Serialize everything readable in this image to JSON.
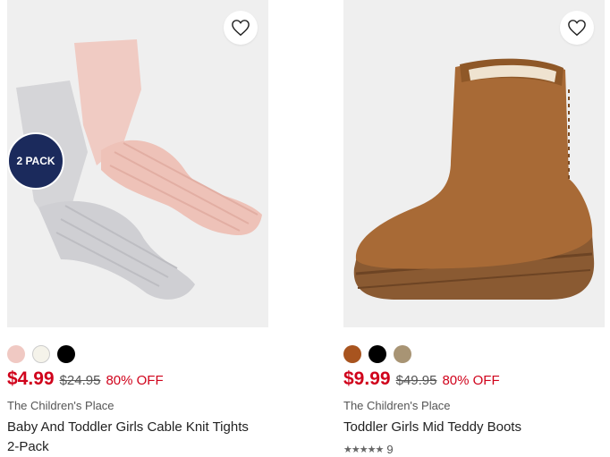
{
  "products": [
    {
      "name": "Baby And Toddler Girls Cable Knit Tights 2-Pack",
      "brand": "The Children's Place",
      "sale_price": "$4.99",
      "original_price": "$24.95",
      "discount": "80% OFF",
      "badge": "2 PACK",
      "swatches": [
        "#f0c9c3",
        "#f5f3ea",
        "#000000"
      ],
      "wishlist_icon": "heart-outline-icon"
    },
    {
      "name": "Toddler Girls Mid Teddy Boots",
      "brand": "The Children's Place",
      "sale_price": "$9.99",
      "original_price": "$49.95",
      "discount": "80% OFF",
      "rating_count": "9",
      "rating_stars": "★★★★★",
      "swatches": [
        "#a8541f",
        "#000000",
        "#a89474"
      ],
      "wishlist_icon": "heart-outline-icon"
    }
  ],
  "colors": {
    "sale": "#d0021b",
    "badge": "#1b2a5c"
  }
}
